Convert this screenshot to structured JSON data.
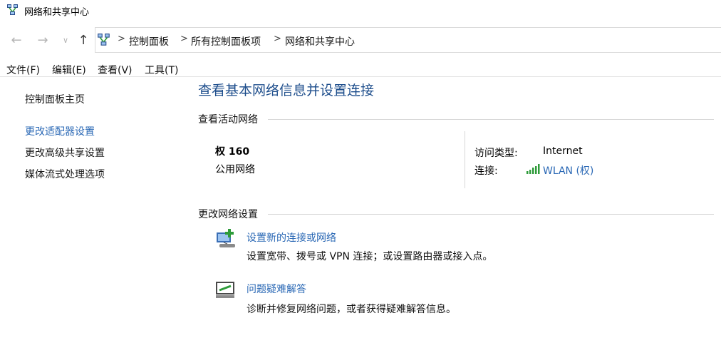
{
  "window": {
    "title": "网络和共享中心",
    "icon": "network-center-icon"
  },
  "nav": {
    "back_icon": "back-arrow-icon",
    "forward_icon": "forward-arrow-icon",
    "recent_icon": "chevron-down-icon",
    "up_icon": "up-arrow-icon",
    "breadcrumb": [
      "控制面板",
      "所有控制面板项",
      "网络和共享中心"
    ],
    "separator": ">"
  },
  "menubar": {
    "items": [
      "文件(F)",
      "编辑(E)",
      "查看(V)",
      "工具(T)"
    ]
  },
  "sidebar": {
    "home": "控制面板主页",
    "items": [
      "更改适配器设置",
      "更改高级共享设置",
      "媒体流式处理选项"
    ],
    "active_index": 0
  },
  "main": {
    "heading": "查看基本网络信息并设置连接",
    "active_networks_title": "查看活动网络",
    "network": {
      "name": "权 160",
      "category": "公用网络",
      "access_type_label": "访问类型:",
      "access_type_value": "Internet",
      "connection_label": "连接:",
      "connection_value": "WLAN (权)",
      "connection_icon": "wifi-signal-icon"
    },
    "change_settings_title": "更改网络设置",
    "tasks": [
      {
        "title": "设置新的连接或网络",
        "desc": "设置宽带、拨号或 VPN 连接；或设置路由器或接入点。",
        "icon": "new-connection-icon"
      },
      {
        "title": "问题疑难解答",
        "desc": "诊断并修复网络问题，或者获得疑难解答信息。",
        "icon": "troubleshoot-icon"
      }
    ]
  },
  "colors": {
    "link": "#2a68b5",
    "heading": "#1e4e8c",
    "wifi": "#2e9b3a"
  }
}
